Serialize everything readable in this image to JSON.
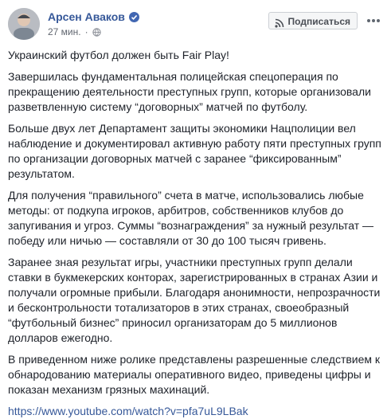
{
  "post": {
    "author": "Арсен Аваков",
    "time": "27 мин.",
    "subscribe_label": "Подписаться",
    "paragraphs": [
      "Украинский футбол должен быть Fair Play!",
      "Завершилась фундаментальная полицейская спецоперация по прекращению деятельности преступных групп, которые организовали разветвленную систему “договорных” матчей по футболу.",
      "Больше двух лет Департамент защиты экономики Нацполиции вел наблюдение и документировал активную работу пяти преступных групп по организации договорных матчей с заранее “фиксированным” результатом.",
      "Для получения “правильного” счета в матче, использовались любые методы: от подкупа игроков, арбитров, собственников клубов до запугивания и угроз. Суммы “вознаграждения” за нужный результат — победу или ничью — составляли от 30 до 100 тысяч гривень.",
      "Заранее зная результат игры, участники преступных групп делали ставки в букмекерских конторах, зарегистрированных в странах Азии и получали огромные прибыли. Благодаря анонимности, непрозрачности и бесконтрольности тотализаторов в этих странах, своеобразный “футбольный бизнес” приносил организаторам до 5 миллионов долларов ежегодно.",
      "В приведенном ниже ролике представлены разрешенные следствием к обнародованию материалы оперативного видео, приведены цифры и показан механизм грязных махинаций."
    ],
    "link": "https://www.youtube.com/watch?v=pfa7uL9LBak"
  },
  "colors": {
    "link": "#365899",
    "text": "#1d2129",
    "muted": "#616770",
    "verified": "#4267b2"
  },
  "icons": {
    "verified": "verified-badge-icon",
    "privacy": "globe-icon",
    "subscribe": "rss-icon",
    "more": "more-options-icon"
  }
}
